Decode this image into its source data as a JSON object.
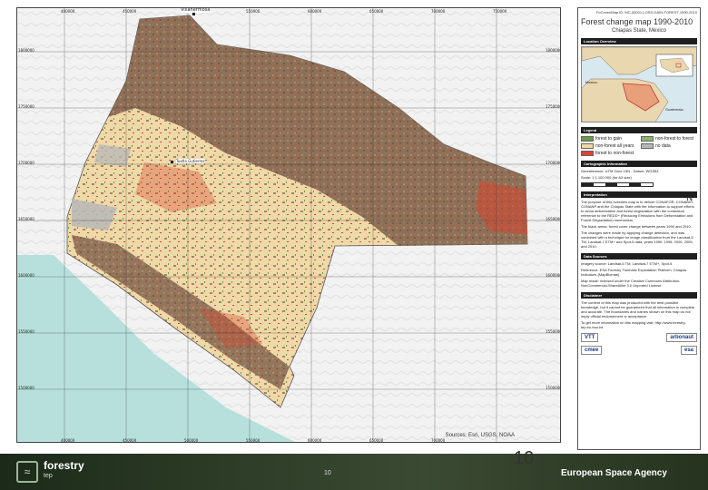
{
  "map": {
    "top_ticks": [
      "400000",
      "450000",
      "500000",
      "550000",
      "600000",
      "650000",
      "700000",
      "750000",
      "800000"
    ],
    "bottom_ticks": [
      "400000",
      "450000",
      "500000",
      "550000",
      "600000",
      "650000",
      "700000",
      "750000"
    ],
    "left_ticks": [
      "1800000",
      "1750000",
      "1700000",
      "1650000",
      "1600000",
      "1550000",
      "1500000",
      "1450000"
    ],
    "right_ticks": [
      "1800000",
      "1750000",
      "1700000",
      "1650000",
      "1600000",
      "1550000",
      "1500000",
      "1450000"
    ],
    "city_labels": [
      "Villahermosa",
      "Tuxtla Gutierrez"
    ],
    "credit": "Sources: Esri, USGS, NOAA",
    "colors": {
      "sea": "#b7e0dd",
      "land": "#efd9a8",
      "forest": "#8a6c55",
      "loss": "#d9452f",
      "gain": "#6a9a3e",
      "nodata": "#b7b7b7"
    }
  },
  "panel": {
    "reference": "FoCover/Map ID: MC-00001-LOSS-GAIN-FOREST-1990-2010",
    "title": "Forest change map 1990-2010",
    "subtitle": "Chiapas State, Mexico",
    "location_header": "Location Overview",
    "overview_labels": [
      "Mexico",
      "Guatemala"
    ],
    "legend_header": "Legend",
    "legend": [
      {
        "label": "forest to gain",
        "color": "#6a9a3e"
      },
      {
        "label": "non-forest to forest",
        "color": "#8ab56a"
      },
      {
        "label": "non-forest all years",
        "color": "#efd9a8"
      },
      {
        "label": "no data",
        "color": "#b7b7b7"
      },
      {
        "label": "forest to non-forest",
        "color": "#d9452f"
      }
    ],
    "carto_header": "Cartographic Information",
    "carto_text": "Georeference: UTM Zone 15N - Datum: WGS84",
    "scale_text": "Scale: 1:1 100 000 (for A3 size)",
    "north": "N",
    "interp_header": "Interpretation",
    "interp_text_1": "The purpose of this overview map is to deliver CONAFOR, CONABIO, CONANP and the Chiapas State with the information to support efforts to avoid deforestation and forest degradation with the contextual reference to the REDD+ (Reducing Emissions from Deforestation and Forest Degradation) mechanism.",
    "interp_text_2": "The black areas: forest cover change between years 1990 and 2010.",
    "interp_text_3": "The changes were made by applying change detection, and was combined with a technique for image classification from the Landsat-5 TM, Landsat-7 ETM+ and Spot-5 data, years 1990, 1995, 2000, 2005, and 2010.",
    "data_header": "Data Sources",
    "data_text_1": "Imagery source: Landsat-5 TM, Landsat-7 ETM+, Spot-5",
    "data_text_2": "Reference: ESA Forestry Thematic Exploitation Platform, Chiapas Indicators (MapBiomas)",
    "data_text_3": "Map made: licensed under the Creative Commons Attribution-NonCommercial-ShareAlike 3.0 Unported License.",
    "disclaimer_header": "Disclaimer",
    "disclaimer_text": "The content of this map was produced with the best possible knowledge, but it cannot be guaranteed that all information is complete and accurate. The boundaries and names shown on this map do not imply official endorsement or acceptance.",
    "contact_text": "To get more information on this mapping visit: http://www.forestry-tep.eo.esa.int",
    "logos": [
      "VTT",
      "arbonaut",
      "cmee",
      "esa"
    ]
  },
  "footer": {
    "brand": "forestry",
    "brand_sub": "tep",
    "page_small": "10",
    "page_big": "10",
    "agency": "European Space Agency"
  }
}
